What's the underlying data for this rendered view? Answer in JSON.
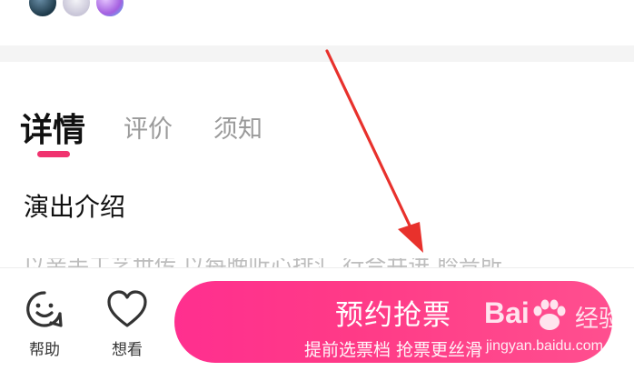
{
  "tabs": [
    {
      "label": "详情",
      "active": true
    },
    {
      "label": "评价",
      "active": false
    },
    {
      "label": "须知",
      "active": false
    }
  ],
  "section": {
    "title": "演出介绍",
    "clipped_text": "以亲手工艺世传 以每晚听心排汇 行合并进 聆音所"
  },
  "bottom_bar": {
    "help_label": "帮助",
    "want_label": "想看",
    "cta_title": "预约抢票",
    "cta_subtitle": "提前选票档 抢票更丝滑"
  },
  "watermark": {
    "logo_text": "Bai",
    "logo_suffix": "经验",
    "url": "jingyan.baidu.com"
  },
  "colors": {
    "accent": "#f0336f",
    "cta_start": "#ff2f8f",
    "cta_end": "#ff4f8f",
    "arrow": "#e8312c"
  },
  "icons": [
    "smile-help-icon",
    "heart-icon",
    "baidu-paw-icon",
    "annotation-arrow"
  ]
}
